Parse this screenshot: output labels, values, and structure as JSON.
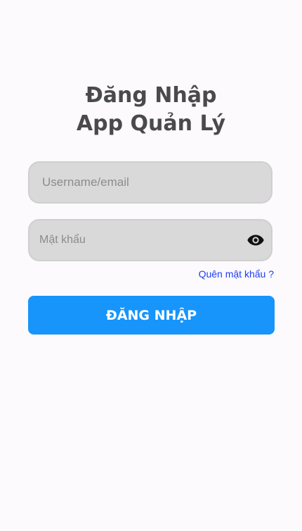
{
  "title": {
    "line1": "Đăng Nhập",
    "line2": "App Quản Lý"
  },
  "username": {
    "placeholder": "Username/email",
    "value": ""
  },
  "password": {
    "placeholder": "Mật khẩu",
    "value": "",
    "toggle_icon": "eye-icon"
  },
  "forgot_password": {
    "label": "Quên mật khẩu ?"
  },
  "login_button": {
    "label": "ĐĂNG NHẬP"
  },
  "colors": {
    "background": "#fdfafd",
    "input_background": "#d9d9d9",
    "primary": "#1795fb",
    "link": "#1b3ff5",
    "title": "#4a4a4e"
  }
}
